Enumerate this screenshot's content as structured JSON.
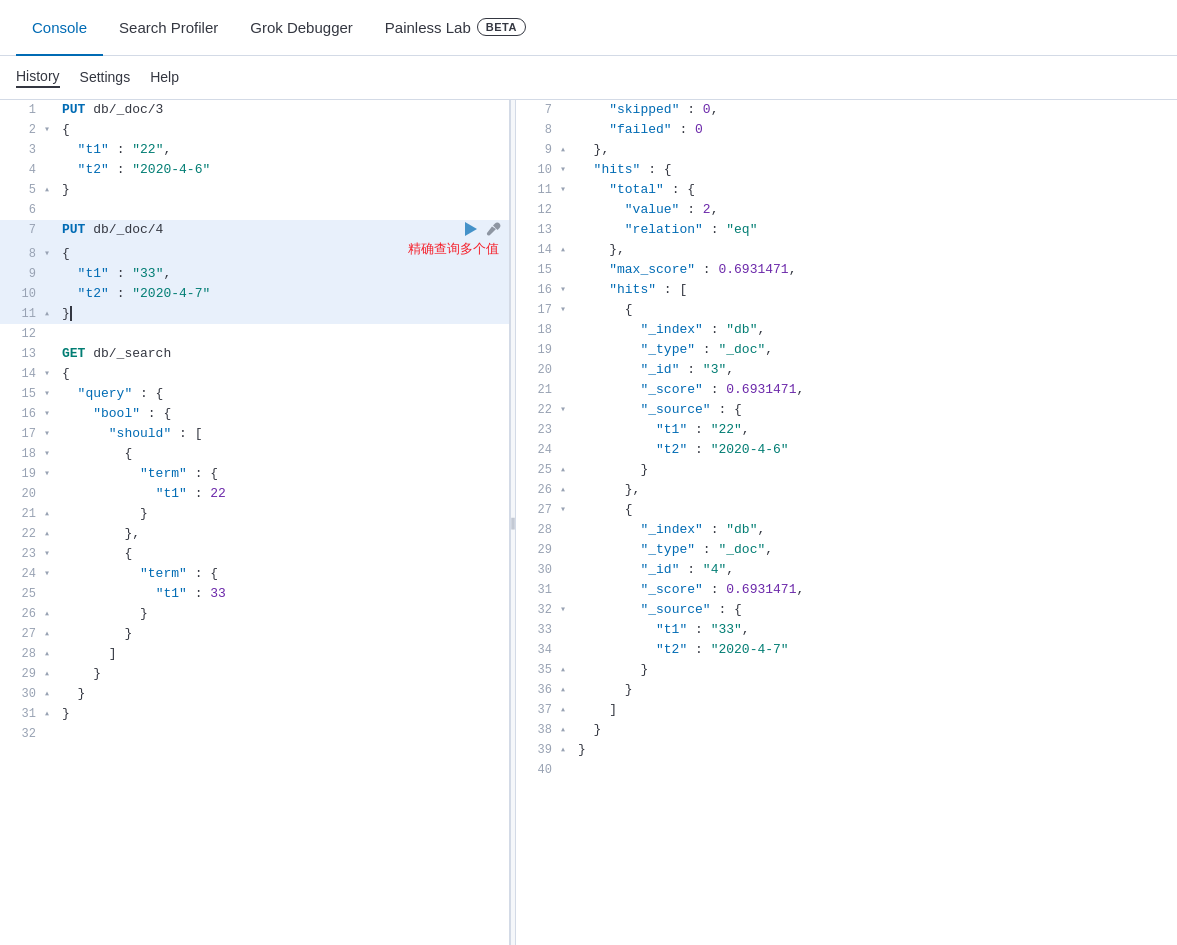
{
  "topNav": {
    "items": [
      {
        "label": "Console",
        "active": true
      },
      {
        "label": "Search Profiler",
        "active": false
      },
      {
        "label": "Grok Debugger",
        "active": false
      },
      {
        "label": "Painless Lab",
        "active": false,
        "badge": "BETA"
      }
    ]
  },
  "subNav": {
    "items": [
      {
        "label": "History",
        "active": true
      },
      {
        "label": "Settings",
        "active": false
      },
      {
        "label": "Help",
        "active": false
      }
    ]
  },
  "leftLines": [
    {
      "num": 1,
      "fold": "",
      "content": "PUT db/_doc/3",
      "type": "method",
      "method": "PUT"
    },
    {
      "num": 2,
      "fold": "▾",
      "content": "{",
      "type": "plain"
    },
    {
      "num": 3,
      "fold": "",
      "content": "  \"t1\": \"22\",",
      "type": "plain"
    },
    {
      "num": 4,
      "fold": "",
      "content": "  \"t2\": \"2020-4-6\"",
      "type": "plain"
    },
    {
      "num": 5,
      "fold": "▴",
      "content": "}",
      "type": "plain"
    },
    {
      "num": 6,
      "fold": "",
      "content": "",
      "type": "plain"
    },
    {
      "num": 7,
      "fold": "",
      "content": "PUT db/_doc/4",
      "type": "method",
      "method": "PUT",
      "highlighted": true,
      "hasActions": true
    },
    {
      "num": 8,
      "fold": "▾",
      "content": "{",
      "type": "plain",
      "highlighted": true
    },
    {
      "num": 9,
      "fold": "",
      "content": "  \"t1\": \"33\",",
      "type": "plain",
      "highlighted": true
    },
    {
      "num": 10,
      "fold": "",
      "content": "  \"t2\": \"2020-4-7\"",
      "type": "plain",
      "highlighted": true
    },
    {
      "num": 11,
      "fold": "▴",
      "content": "}",
      "type": "plain",
      "highlighted": true,
      "cursor": true
    },
    {
      "num": 12,
      "fold": "",
      "content": "",
      "type": "plain"
    },
    {
      "num": 13,
      "fold": "",
      "content": "GET db/_search",
      "type": "method",
      "method": "GET"
    },
    {
      "num": 14,
      "fold": "▾",
      "content": "{",
      "type": "plain"
    },
    {
      "num": 15,
      "fold": "▾",
      "content": "  \"query\": {",
      "type": "plain"
    },
    {
      "num": 16,
      "fold": "▾",
      "content": "    \"bool\": {",
      "type": "plain"
    },
    {
      "num": 17,
      "fold": "▾",
      "content": "      \"should\": [",
      "type": "plain"
    },
    {
      "num": 18,
      "fold": "▾",
      "content": "        {",
      "type": "plain"
    },
    {
      "num": 19,
      "fold": "▾",
      "content": "          \"term\": {",
      "type": "plain"
    },
    {
      "num": 20,
      "fold": "",
      "content": "            \"t1\": 22",
      "type": "plain"
    },
    {
      "num": 21,
      "fold": "▴",
      "content": "          }",
      "type": "plain"
    },
    {
      "num": 22,
      "fold": "▴",
      "content": "        },",
      "type": "plain"
    },
    {
      "num": 23,
      "fold": "▾",
      "content": "        {",
      "type": "plain"
    },
    {
      "num": 24,
      "fold": "▾",
      "content": "          \"term\": {",
      "type": "plain"
    },
    {
      "num": 25,
      "fold": "",
      "content": "            \"t1\": 33",
      "type": "plain"
    },
    {
      "num": 26,
      "fold": "▴",
      "content": "          }",
      "type": "plain"
    },
    {
      "num": 27,
      "fold": "▴",
      "content": "        }",
      "type": "plain"
    },
    {
      "num": 28,
      "fold": "▴",
      "content": "      ]",
      "type": "plain"
    },
    {
      "num": 29,
      "fold": "▴",
      "content": "    }",
      "type": "plain"
    },
    {
      "num": 30,
      "fold": "▴",
      "content": "  }",
      "type": "plain"
    },
    {
      "num": 31,
      "fold": "▴",
      "content": "}",
      "type": "plain"
    },
    {
      "num": 32,
      "fold": "",
      "content": "",
      "type": "plain"
    }
  ],
  "rightLines": [
    {
      "num": 7,
      "fold": "",
      "content": "    \"skipped\" : 0,",
      "keyColor": "key",
      "valColor": "num"
    },
    {
      "num": 8,
      "fold": "",
      "content": "    \"failed\" : 0",
      "keyColor": "key",
      "valColor": "num"
    },
    {
      "num": 9,
      "fold": "▴",
      "content": "  },",
      "keyColor": "plain"
    },
    {
      "num": 10,
      "fold": "▾",
      "content": "  \"hits\" : {",
      "keyColor": "key"
    },
    {
      "num": 11,
      "fold": "▾",
      "content": "    \"total\" : {",
      "keyColor": "key"
    },
    {
      "num": 12,
      "fold": "",
      "content": "      \"value\" : 2,",
      "keyColor": "key",
      "valColor": "num"
    },
    {
      "num": 13,
      "fold": "",
      "content": "      \"relation\" : \"eq\"",
      "keyColor": "key",
      "valColor": "str"
    },
    {
      "num": 14,
      "fold": "▴",
      "content": "    },",
      "keyColor": "plain"
    },
    {
      "num": 15,
      "fold": "",
      "content": "    \"max_score\" : 0.6931471,",
      "keyColor": "key",
      "valColor": "num"
    },
    {
      "num": 16,
      "fold": "▾",
      "content": "    \"hits\" : [",
      "keyColor": "key"
    },
    {
      "num": 17,
      "fold": "▾",
      "content": "      {",
      "keyColor": "plain"
    },
    {
      "num": 18,
      "fold": "",
      "content": "        \"_index\" : \"db\",",
      "keyColor": "key",
      "valColor": "str"
    },
    {
      "num": 19,
      "fold": "",
      "content": "        \"_type\" : \"_doc\",",
      "keyColor": "key",
      "valColor": "str"
    },
    {
      "num": 20,
      "fold": "",
      "content": "        \"_id\" : \"3\",",
      "keyColor": "key",
      "valColor": "str"
    },
    {
      "num": 21,
      "fold": "",
      "content": "        \"_score\" : 0.6931471,",
      "keyColor": "key",
      "valColor": "num"
    },
    {
      "num": 22,
      "fold": "▾",
      "content": "        \"_source\" : {",
      "keyColor": "key"
    },
    {
      "num": 23,
      "fold": "",
      "content": "          \"t1\" : \"22\",",
      "keyColor": "key",
      "valColor": "str"
    },
    {
      "num": 24,
      "fold": "",
      "content": "          \"t2\" : \"2020-4-6\"",
      "keyColor": "key",
      "valColor": "str"
    },
    {
      "num": 25,
      "fold": "▴",
      "content": "        }",
      "keyColor": "plain"
    },
    {
      "num": 26,
      "fold": "▴",
      "content": "      },",
      "keyColor": "plain"
    },
    {
      "num": 27,
      "fold": "▾",
      "content": "      {",
      "keyColor": "plain"
    },
    {
      "num": 28,
      "fold": "",
      "content": "        \"_index\" : \"db\",",
      "keyColor": "key",
      "valColor": "str"
    },
    {
      "num": 29,
      "fold": "",
      "content": "        \"_type\" : \"_doc\",",
      "keyColor": "key",
      "valColor": "str"
    },
    {
      "num": 30,
      "fold": "",
      "content": "        \"_id\" : \"4\",",
      "keyColor": "key",
      "valColor": "str"
    },
    {
      "num": 31,
      "fold": "",
      "content": "        \"_score\" : 0.6931471,",
      "keyColor": "key",
      "valColor": "num"
    },
    {
      "num": 32,
      "fold": "▾",
      "content": "        \"_source\" : {",
      "keyColor": "key"
    },
    {
      "num": 33,
      "fold": "",
      "content": "          \"t1\" : \"33\",",
      "keyColor": "key",
      "valColor": "str"
    },
    {
      "num": 34,
      "fold": "",
      "content": "          \"t2\" : \"2020-4-7\"",
      "keyColor": "key",
      "valColor": "str"
    },
    {
      "num": 35,
      "fold": "▴",
      "content": "        }",
      "keyColor": "plain"
    },
    {
      "num": 36,
      "fold": "▴",
      "content": "      }",
      "keyColor": "plain"
    },
    {
      "num": 37,
      "fold": "▴",
      "content": "    ]",
      "keyColor": "plain"
    },
    {
      "num": 38,
      "fold": "▴",
      "content": "  }",
      "keyColor": "plain"
    },
    {
      "num": 39,
      "fold": "▴",
      "content": "}",
      "keyColor": "plain"
    },
    {
      "num": 40,
      "fold": "",
      "content": "",
      "keyColor": "plain"
    }
  ],
  "annotation": "精确查询多个值",
  "colors": {
    "active": "#006bb4",
    "put": "#006bb4",
    "get": "#017d73",
    "key": "#006bb4",
    "strVal": "#017d73",
    "numVal": "#6c29aa",
    "annotation": "#f5222d"
  }
}
